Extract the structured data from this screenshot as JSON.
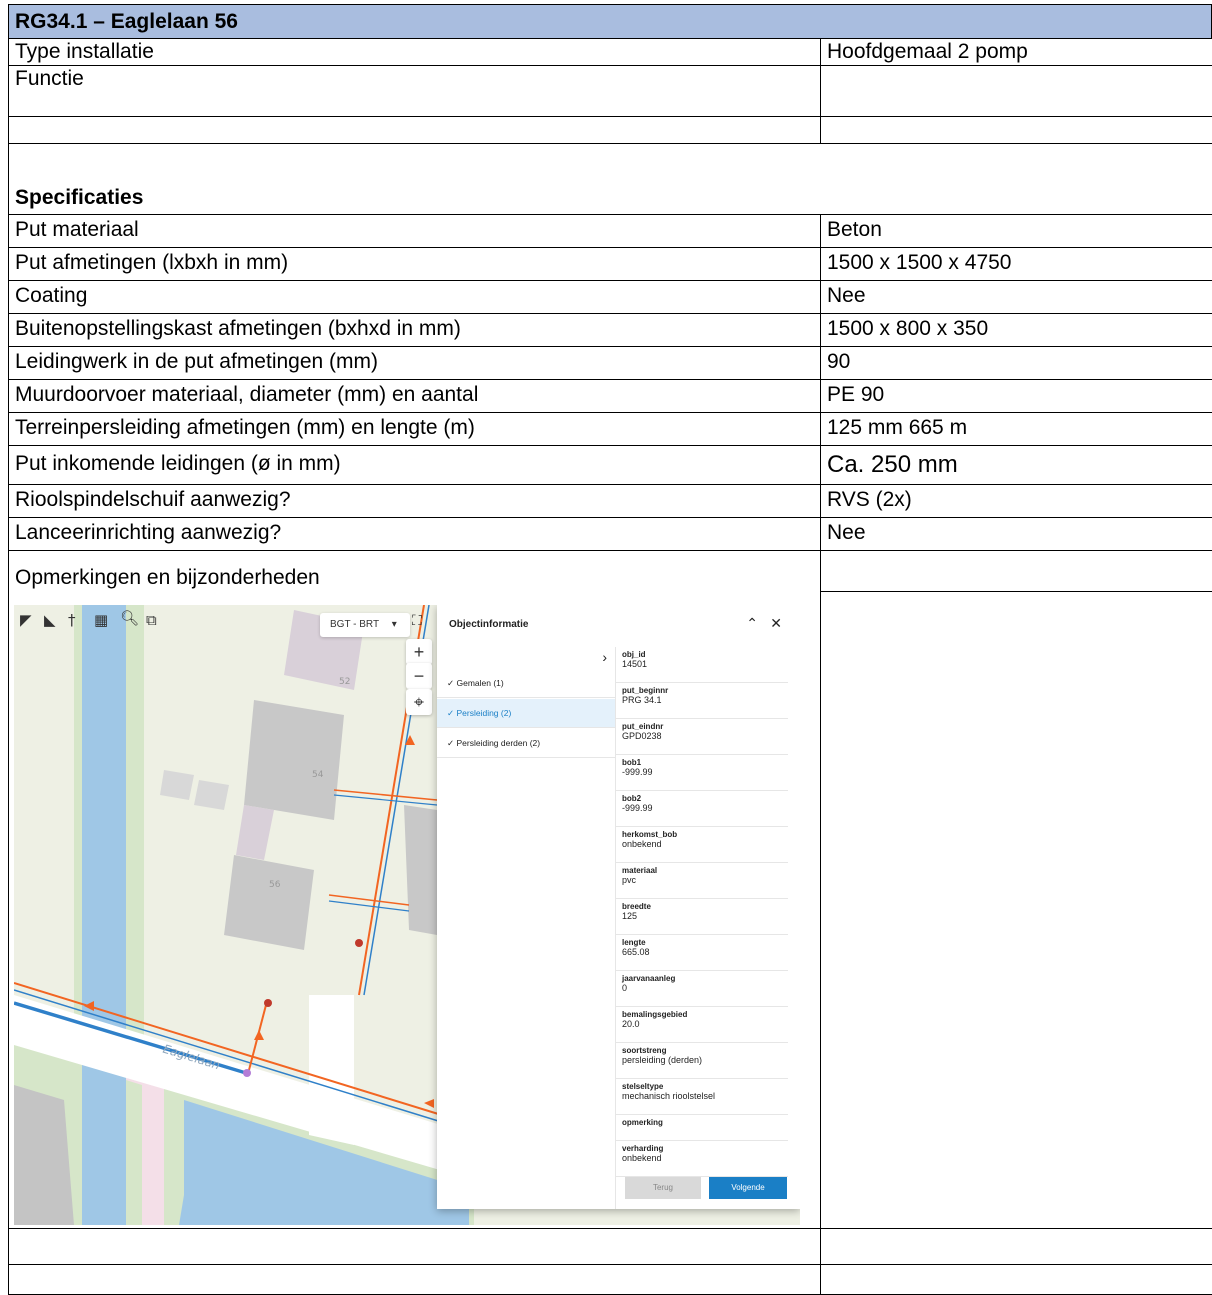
{
  "header": {
    "title": "RG34.1 – Eaglelaan 56"
  },
  "general_rows": [
    {
      "label": "Type installatie",
      "value": "Hoofdgemaal 2 pomp"
    },
    {
      "label": "Functie",
      "value": ""
    },
    {
      "label": "",
      "value": ""
    }
  ],
  "spec_title": "Specificaties",
  "spec_rows": [
    {
      "label": "Put materiaal",
      "value": "Beton"
    },
    {
      "label": "Put afmetingen (lxbxh in mm)",
      "value": "1500 x 1500 x 4750"
    },
    {
      "label": "Coating",
      "value": "Nee"
    },
    {
      "label": "Buitenopstellingskast afmetingen (bxhxd in mm)",
      "value": "1500 x 800 x 350"
    },
    {
      "label": "Leidingwerk in de put afmetingen (mm)",
      "value": "90"
    },
    {
      "label": "Muurdoorvoer materiaal, diameter (mm) en aantal",
      "value": "PE 90"
    },
    {
      "label": "Terreinpersleiding afmetingen (mm) en lengte (m)",
      "value": "125 mm 665 m"
    },
    {
      "label": "Put inkomende leidingen (ø in mm)",
      "value": "Ca. 250 mm"
    },
    {
      "label": "Rioolspindelschuif aanwezig?",
      "value": "RVS (2x)"
    },
    {
      "label": "Lanceerinrichting aanwezig?",
      "value": "Nee"
    },
    {
      "label": "Opmerkingen en bijzonderheden",
      "value": ""
    }
  ],
  "bottom_rows": [
    {
      "label": "",
      "value": ""
    },
    {
      "label": "",
      "value": ""
    }
  ],
  "map": {
    "layer_select": "BGT - BRT",
    "street_label": "Eaglelaan",
    "house_numbers": [
      "52",
      "54",
      "56"
    ],
    "colors": {
      "water": "#9fc7e6",
      "grass": "#d6e6c9",
      "building": "#c4c4c4",
      "pipe_orange": "#f26522",
      "pipe_blue": "#2f80c9"
    }
  },
  "panel": {
    "title": "Objectinformatie",
    "layers": [
      {
        "label": "✓ Gemalen (1)",
        "selected": false
      },
      {
        "label": "✓ Persleiding (2)",
        "selected": true
      },
      {
        "label": "✓ Persleiding derden (2)",
        "selected": false
      }
    ],
    "attributes": [
      {
        "key": "obj_id",
        "value": "14501"
      },
      {
        "key": "put_beginnr",
        "value": "PRG 34.1"
      },
      {
        "key": "put_eindnr",
        "value": "GPD0238"
      },
      {
        "key": "bob1",
        "value": "-999.99"
      },
      {
        "key": "bob2",
        "value": "-999.99"
      },
      {
        "key": "herkomst_bob",
        "value": "onbekend"
      },
      {
        "key": "materiaal",
        "value": "pvc"
      },
      {
        "key": "breedte",
        "value": "125"
      },
      {
        "key": "lengte",
        "value": "665.08"
      },
      {
        "key": "jaarvanaanleg",
        "value": "0"
      },
      {
        "key": "bemalingsgebied",
        "value": "20.0"
      },
      {
        "key": "soortstreng",
        "value": "persleiding (derden)"
      },
      {
        "key": "stelseltype",
        "value": "mechanisch rioolstelsel"
      },
      {
        "key": "opmerking",
        "value": ""
      },
      {
        "key": "verharding",
        "value": "onbekend"
      }
    ],
    "back_label": "Terug",
    "next_label": "Volgende"
  }
}
